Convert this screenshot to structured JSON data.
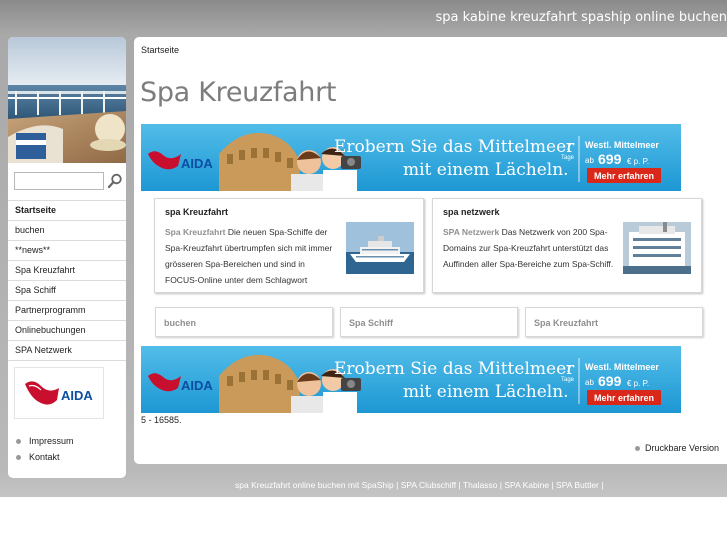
{
  "header": {
    "tagline": "spa kabine kreuzfahrt spaship online buchen"
  },
  "search": {
    "placeholder": ""
  },
  "nav": {
    "items": [
      {
        "label": "Startseite",
        "active": true
      },
      {
        "label": "buchen"
      },
      {
        "label": "**news**"
      },
      {
        "label": "Spa Kreuzfahrt"
      },
      {
        "label": "Spa Schiff"
      },
      {
        "label": "Partnerprogramm"
      },
      {
        "label": "Onlinebuchungen"
      },
      {
        "label": "SPA Netzwerk"
      }
    ]
  },
  "aida_logo_text": "AIDA",
  "meta": {
    "impressum": "Impressum",
    "kontakt": "Kontakt"
  },
  "breadcrumb": "Startseite",
  "page_title": "Spa Kreuzfahrt",
  "banner": {
    "brand": "AIDA",
    "headline1": "Erobern Sie das Mittelmeer",
    "headline2": "mit einem Lächeln.",
    "days": "7",
    "days_label": "Tage",
    "route": "Westl. Mittelmeer",
    "price_prefix": "ab",
    "price": "699",
    "price_suffix": "€ p. P.",
    "cta": "Mehr erfahren"
  },
  "boxes": [
    {
      "title": "spa Kreuzfahrt",
      "link": "Spa Kreuzfahrt",
      "text": " Die neuen Spa-Schiffe der Spa-Kreuzfahrt übertrumpfen sich mit immer grösseren Spa-Bereichen und sind in FOCUS-Online unter dem Schlagwort"
    },
    {
      "title": "spa netzwerk",
      "link": "SPA Netzwerk",
      "text": " Das Netzwerk von 200 Spa-Domains zur Spa-Kreuzfahrt unterstützt das Auffinden aller Spa-Bereiche zum Spa-Schiff."
    }
  ],
  "teasers": [
    "buchen",
    "Spa Schiff",
    "Spa Kreuzfahrt"
  ],
  "counter": "5 - 16585.",
  "print_label": "Druckbare Version",
  "footer": {
    "links": [
      "spa Kreuzfahrt online buchen mit SpaShip",
      "SPA Clubschiff",
      "Thalasso",
      "SPA Kabine",
      "SPA Buttler"
    ]
  },
  "colors": {
    "banner_bg": "#2aa7e0",
    "banner_cta": "#d9281a",
    "aida_red": "#c8102e",
    "heading_gray": "#7d7d7d"
  }
}
